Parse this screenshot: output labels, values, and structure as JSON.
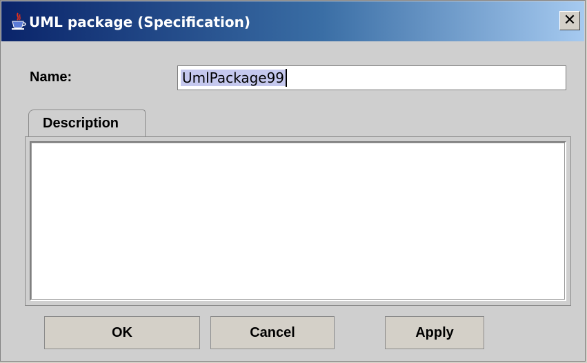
{
  "window": {
    "title": "UML package (Specification)",
    "close_icon": "close-icon",
    "app_icon": "java-cup-icon"
  },
  "form": {
    "name_label": "Name:",
    "name_value": "UmlPackage99"
  },
  "tabs": [
    {
      "label": "Description",
      "selected": true
    }
  ],
  "description": {
    "value": ""
  },
  "buttons": {
    "ok": "OK",
    "cancel": "Cancel",
    "apply": "Apply"
  },
  "colors": {
    "title_gradient_start": "#0a246a",
    "title_gradient_end": "#a6caf0",
    "dialog_bg": "#cfcfcf",
    "selection_bg": "#c5c8ee"
  }
}
